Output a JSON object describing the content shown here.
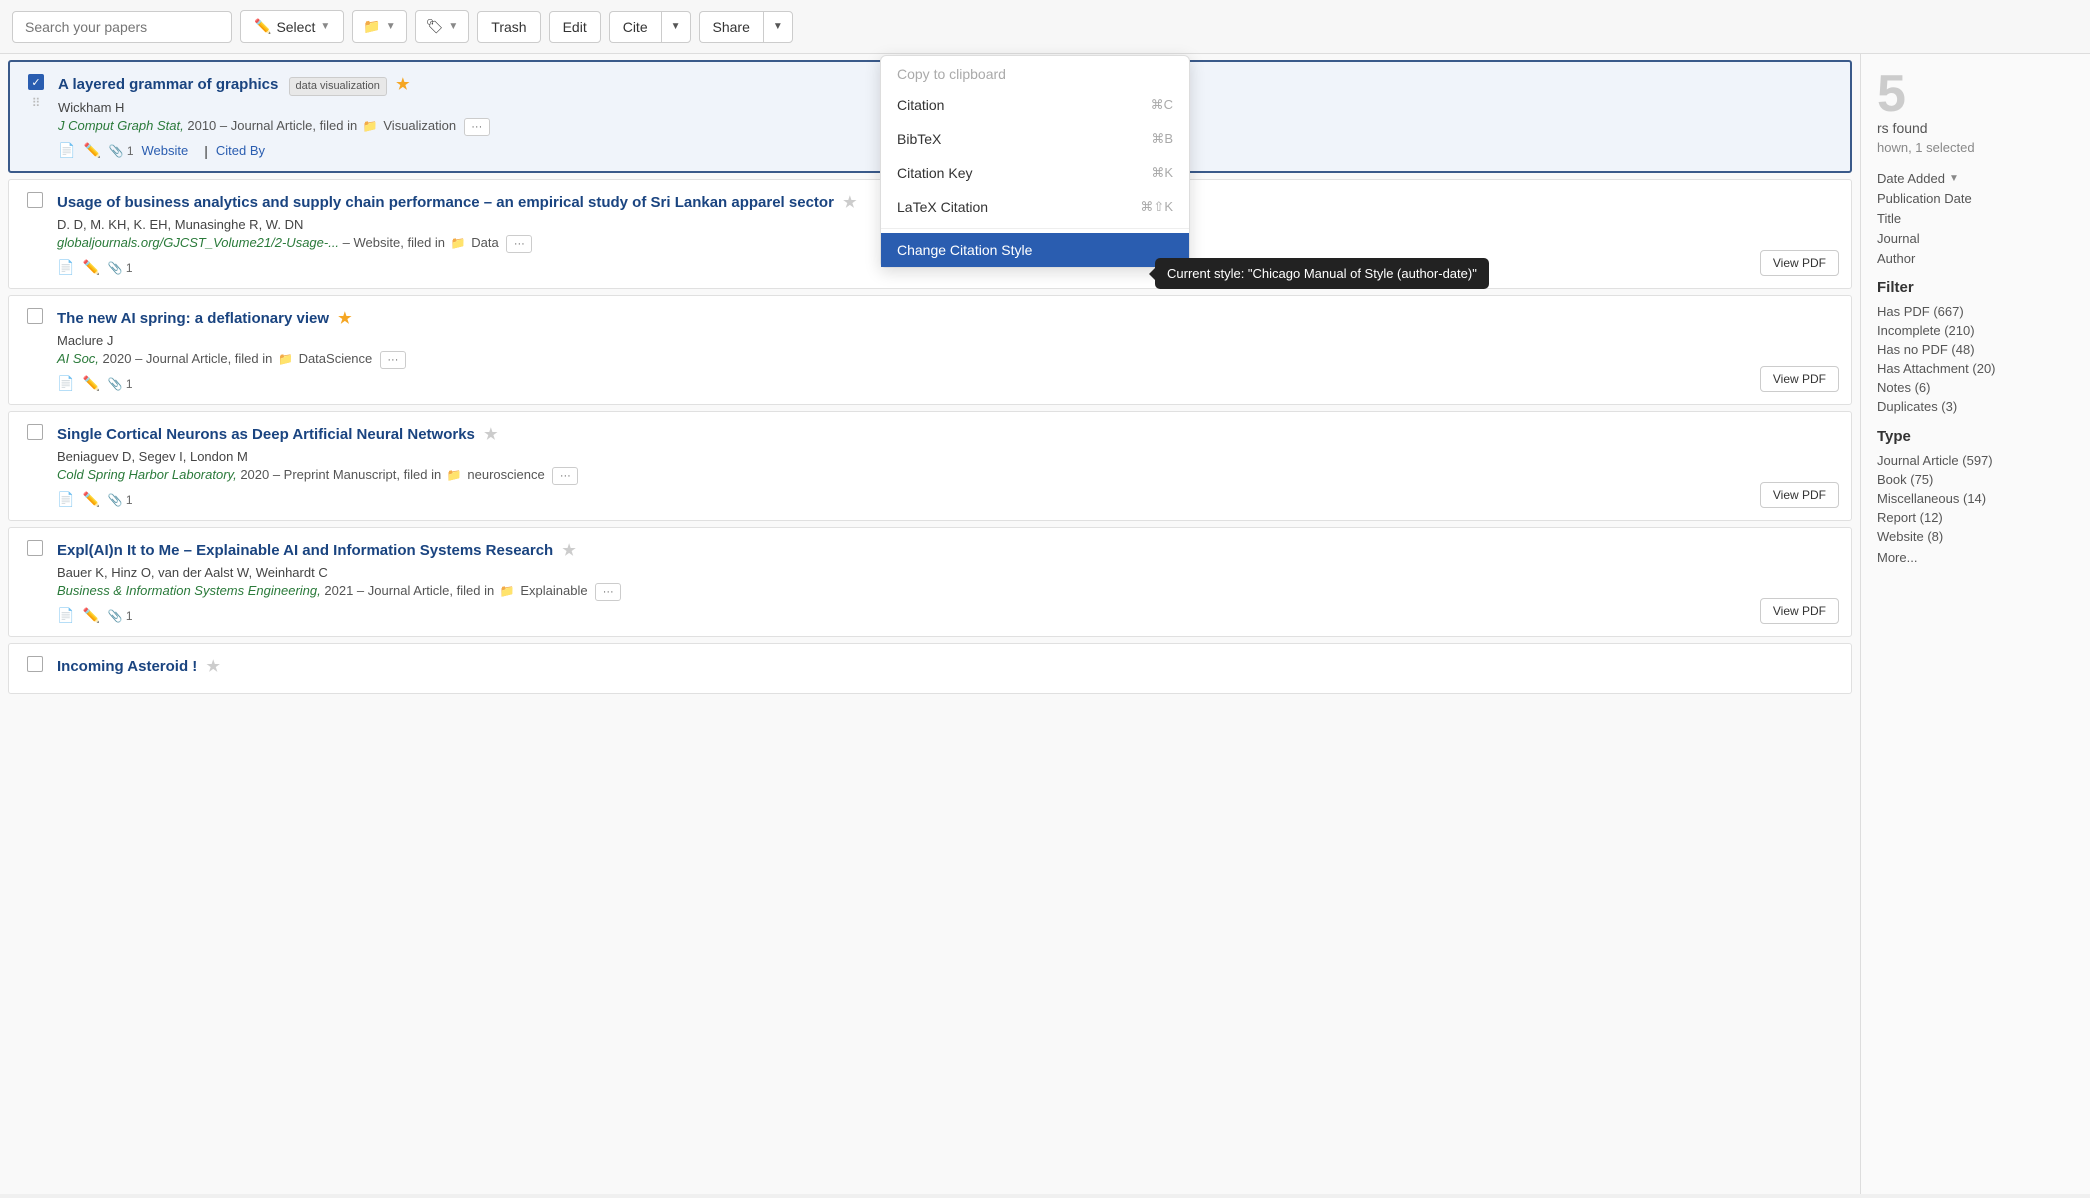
{
  "toolbar": {
    "search_placeholder": "Search your papers",
    "select_label": "Select",
    "trash_label": "Trash",
    "edit_label": "Edit",
    "cite_label": "Cite",
    "share_label": "Share"
  },
  "dropdown": {
    "header": "Copy to clipboard",
    "items": [
      {
        "label": "Citation",
        "shortcut": "⌘C"
      },
      {
        "label": "BibTeX",
        "shortcut": "⌘B"
      },
      {
        "label": "Citation Key",
        "shortcut": "⌘K"
      },
      {
        "label": "LaTeX Citation",
        "shortcut": "⌘⇧K"
      }
    ],
    "change_style": "Change Citation Style"
  },
  "tooltip": {
    "text": "Current style: \"Chicago Manual of Style (author-date)\""
  },
  "papers": [
    {
      "id": 1,
      "selected": true,
      "title": "A layered grammar of graphics",
      "tag": "data visualization",
      "starred": true,
      "authors": "Wickham H",
      "journal": "J Comput Graph Stat,",
      "year": "2010",
      "type": "Journal Article",
      "folder": "Visualization",
      "has_website": true,
      "website_label": "Website",
      "cited_by_label": "Cited By",
      "attachment_count": "1"
    },
    {
      "id": 2,
      "selected": false,
      "title": "Usage of business analytics and supply chain performance – an empirical study of Sri Lankan apparel sector",
      "tag": null,
      "starred": false,
      "authors": "D. D, M. KH, K. EH, Munasinghe R, W. DN",
      "journal": null,
      "source_url": "globaljournals.org/GJCST_Volume21/2-Usage-...",
      "year": null,
      "type": "Website",
      "folder": "Data",
      "has_website": false,
      "attachment_count": "1",
      "view_pdf": "View PDF"
    },
    {
      "id": 3,
      "selected": false,
      "title": "The new AI spring: a deflationary view",
      "tag": null,
      "starred": true,
      "authors": "Maclure J",
      "journal": "AI Soc,",
      "year": "2020",
      "type": "Journal Article",
      "folder": "DataScience",
      "has_website": false,
      "attachment_count": "1",
      "view_pdf": "View PDF"
    },
    {
      "id": 4,
      "selected": false,
      "title": "Single Cortical Neurons as Deep Artificial Neural Networks",
      "tag": null,
      "starred": false,
      "authors": "Beniaguev D, Segev I, London M",
      "journal": "Cold Spring Harbor Laboratory,",
      "year": "2020",
      "type": "Preprint Manuscript",
      "folder": "neuroscience",
      "has_website": false,
      "attachment_count": "1",
      "view_pdf": "View PDF"
    },
    {
      "id": 5,
      "selected": false,
      "title": "Expl(AI)n It to Me – Explainable AI and Information Systems Research",
      "tag": null,
      "starred": false,
      "authors": "Bauer K, Hinz O, van der Aalst W, Weinhardt C",
      "journal": "Business & Information Systems Engineering,",
      "year": "2021",
      "type": "Journal Article",
      "folder": "Explainable",
      "has_website": false,
      "attachment_count": "1",
      "view_pdf": "View PDF"
    },
    {
      "id": 6,
      "selected": false,
      "title": "Incoming Asteroid !",
      "tag": null,
      "starred": false,
      "authors": "",
      "journal": null,
      "year": null,
      "type": null,
      "folder": null,
      "has_website": false
    }
  ],
  "sidebar": {
    "count": "5",
    "found_label": "rs found",
    "shown_label": "hown, 1 selected",
    "sort_label": "Date Added",
    "sort_options": [
      "Publication Date",
      "Title",
      "Journal",
      "Author"
    ],
    "filter_title": "Filter",
    "filters": [
      "Has PDF (667)",
      "Incomplete (210)",
      "Has no PDF (48)",
      "Has Attachment (20)",
      "Notes (6)",
      "Duplicates (3)"
    ],
    "type_title": "Type",
    "types": [
      "Journal Article (597)",
      "Book (75)",
      "Miscellaneous (14)",
      "Report (12)",
      "Website (8)"
    ],
    "more_label": "More..."
  }
}
